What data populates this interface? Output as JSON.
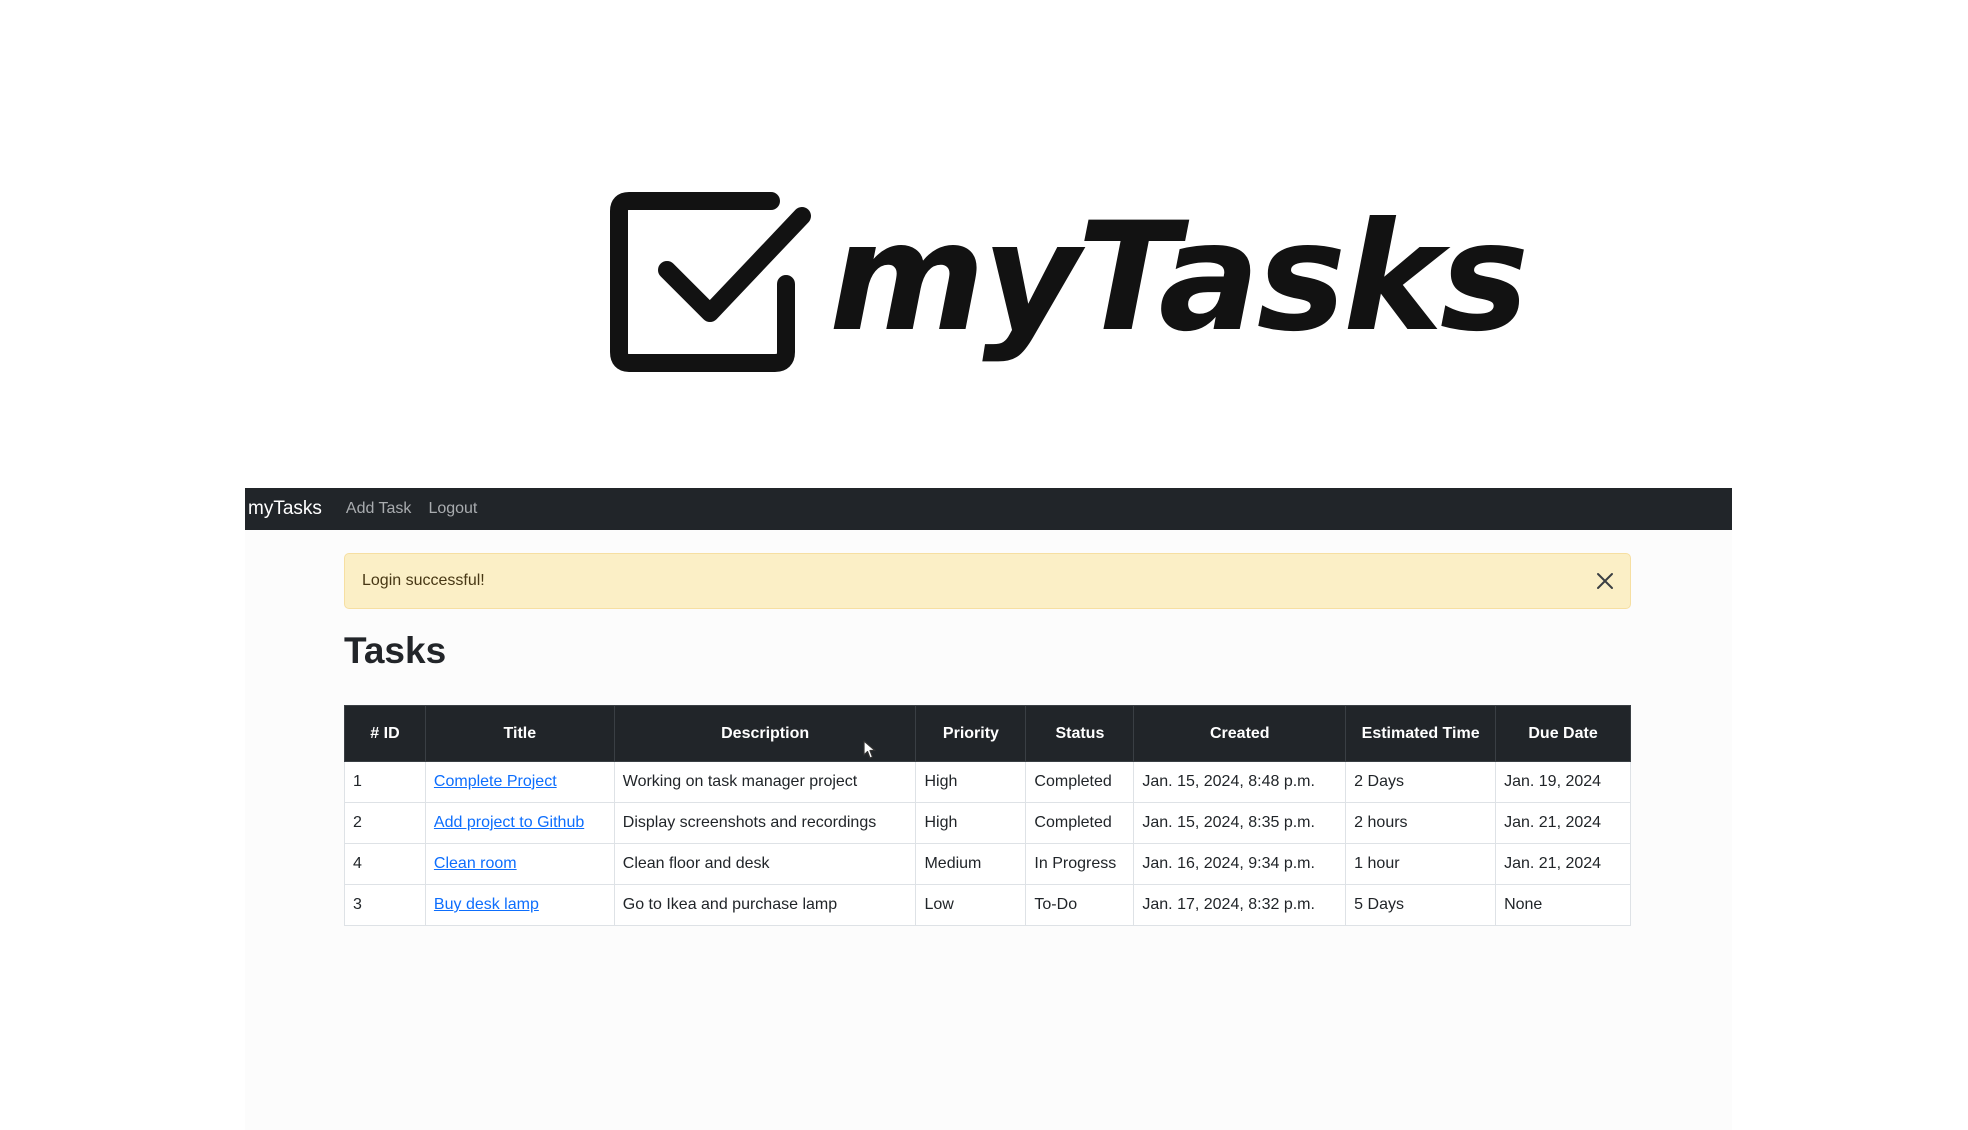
{
  "logo": {
    "text": "myTasks",
    "icon": "checkbox-check-icon"
  },
  "navbar": {
    "brand": "myTasks",
    "links": [
      "Add Task",
      "Logout"
    ],
    "background": "#212529"
  },
  "alert": {
    "message": "Login successful!",
    "close_icon": "close-icon",
    "background": "#fbefc6"
  },
  "page": {
    "title": "Tasks"
  },
  "table": {
    "headers": [
      "# ID",
      "Title",
      "Description",
      "Priority",
      "Status",
      "Created",
      "Estimated Time",
      "Due Date"
    ],
    "rows": [
      {
        "id": "1",
        "title": "Complete Project",
        "description": "Working on task manager project",
        "priority": "High",
        "status": "Completed",
        "created": "Jan. 15, 2024, 8:48 p.m.",
        "estimated": "2 Days",
        "due": "Jan. 19, 2024"
      },
      {
        "id": "2",
        "title": "Add project to Github",
        "description": "Display screenshots and recordings",
        "priority": "High",
        "status": "Completed",
        "created": "Jan. 15, 2024, 8:35 p.m.",
        "estimated": "2 hours",
        "due": "Jan. 21, 2024"
      },
      {
        "id": "4",
        "title": "Clean room",
        "description": "Clean floor and desk",
        "priority": "Medium",
        "status": "In Progress",
        "created": "Jan. 16, 2024, 9:34 p.m.",
        "estimated": "1 hour",
        "due": "Jan. 21, 2024"
      },
      {
        "id": "3",
        "title": "Buy desk lamp",
        "description": "Go to Ikea and purchase lamp",
        "priority": "Low",
        "status": "To-Do",
        "created": "Jan. 17, 2024, 8:32 p.m.",
        "estimated": "5 Days",
        "due": "None"
      }
    ]
  },
  "colors": {
    "link": "#0d6efd",
    "header_bg": "#212529"
  }
}
